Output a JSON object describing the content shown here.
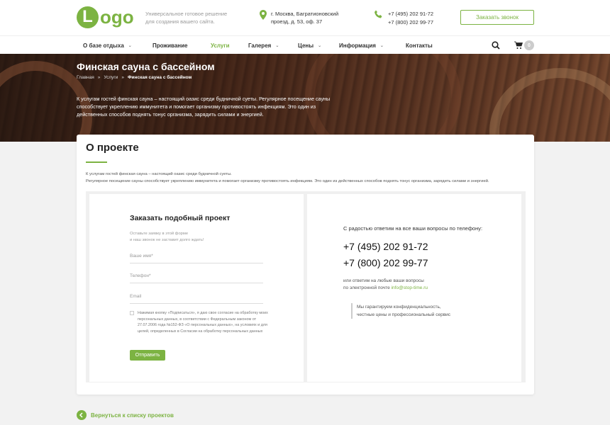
{
  "header": {
    "logo_letter": "L",
    "logo_text": "ogo",
    "tagline_line1": "Универсальное готовое решение",
    "tagline_line2": "для создания вашего сайта.",
    "address_line1": "г. Москва, Багратионовский",
    "address_line2": "проезд, д. 53, оф. 37",
    "phone1": "+7 (495) 202 91-72",
    "phone2": "+7 (800) 202 99-77",
    "callback_label": "Заказать звонок"
  },
  "nav": {
    "items": [
      {
        "label": "О базе отдыха",
        "has_dropdown": true
      },
      {
        "label": "Проживание",
        "has_dropdown": false
      },
      {
        "label": "Услуги",
        "has_dropdown": false,
        "active": true
      },
      {
        "label": "Галерея",
        "has_dropdown": true
      },
      {
        "label": "Цены",
        "has_dropdown": true
      },
      {
        "label": "Информация",
        "has_dropdown": true
      },
      {
        "label": "Контакты",
        "has_dropdown": false
      }
    ],
    "cart_count": "0"
  },
  "hero": {
    "title": "Финская сауна с бассейном",
    "breadcrumb": [
      "Главная",
      "Услуги",
      "Финская сауна с бассейном"
    ],
    "description": "К услугам гостей финская сауна – настоящий оазис среди будничной суеты. Регулярное посещение сауны способствует укреплению иммунитета и помогает организму противостоять инфекциям. Это один из действенных способов поднять тонус организма, зарядить силами и энергией."
  },
  "project": {
    "title": "О проекте",
    "desc_line1": "К услугам гостей финская сауна – настоящий оазис среди будничной суеты.",
    "desc_line2": "Регулярное посещение сауны способствует укреплению иммунитета и помогает организму противостоять инфекциям. Это один из действенных способов поднять тонус организма, зарядить силами и энергией."
  },
  "form": {
    "title": "Заказать подобный проект",
    "subtitle_line1": "Оставьте заявку в этой форме",
    "subtitle_line2": "и наш звонок не заставит долго ждать!",
    "name_placeholder": "Ваше имя*",
    "phone_placeholder": "Телефон*",
    "email_placeholder": "Email",
    "consent": "Нажимая кнопку «Подписаться», я даю свое согласие на обработку моих персональных данных, в соответствии с Федеральным законом от 27.07.2006 года №152-ФЗ «О персональных данных», на условиях и для целей, определенных в Согласии на обработку персональных данных",
    "submit_label": "Отправить"
  },
  "contact": {
    "intro": "С радостью ответим на все ваши вопросы по телефону:",
    "phone1": "+7 (495) 202 91-72",
    "phone2": "+7 (800) 202 99-77",
    "email_line1": "или ответим на любые ваши вопросы",
    "email_line2_prefix": "по электронной почте ",
    "email": "info@stop-time.ru",
    "guarantee_line1": "Мы гарантируем конфиденциальность,",
    "guarantee_line2": "честные цены и профессиональный сервис"
  },
  "back_link": "Вернуться к списку проектов",
  "colors": {
    "accent": "#7cb342"
  }
}
